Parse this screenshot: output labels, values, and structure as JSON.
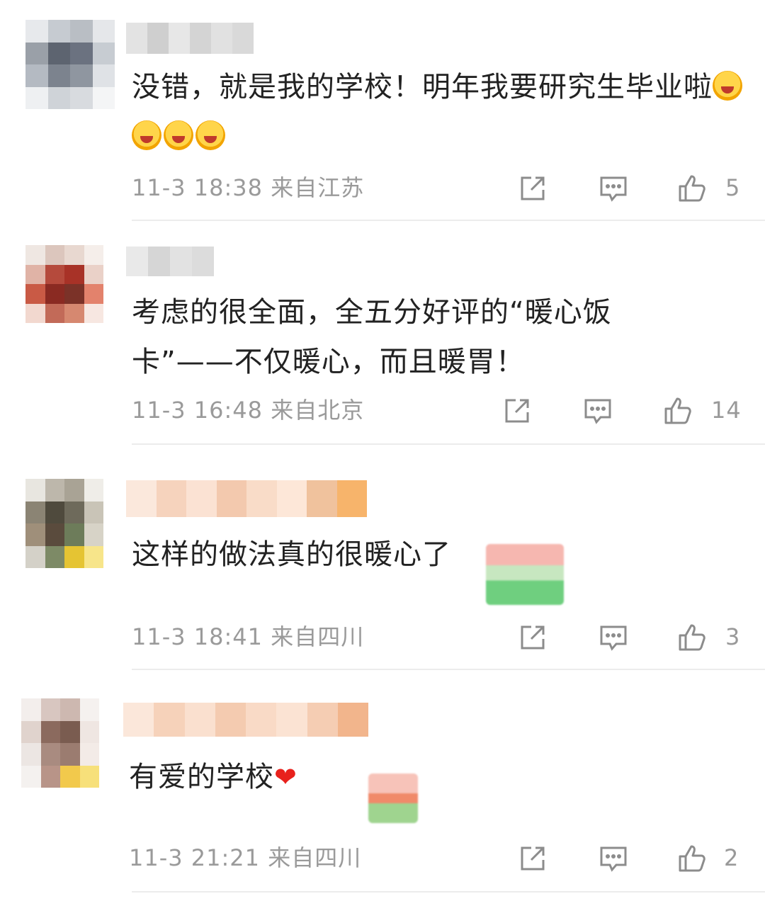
{
  "comments": [
    {
      "text": "没错，就是我的学校！明年我要研究生毕业啦",
      "emoji_icons": [
        "grinning-face-icon",
        "grinning-face-icon",
        "laughing-tears-icon",
        "laughing-tears-icon"
      ],
      "time": "11-3 18:38",
      "location": "来自江苏",
      "likes": "5"
    },
    {
      "text_line1": "考虑的很全面，全五分好评的“暖心饭",
      "text_line2": "卡”——不仅暖心，而且暖胃！",
      "time": "11-3 16:48",
      "location": "来自北京",
      "likes": "14"
    },
    {
      "text": "这样的做法真的很暖心了",
      "time": "11-3 18:41",
      "location": "来自四川",
      "likes": "3"
    },
    {
      "text": "有爱的学校",
      "trailing_icon": "red-heart-icon",
      "heart_glyph": "❤",
      "time": "11-3 21:21",
      "location": "来自四川",
      "likes": "2"
    }
  ],
  "icons": {
    "share": "share-icon",
    "reply": "comment-icon",
    "like": "thumbs-up-icon"
  },
  "colors": {
    "meta_text": "#9a9a9a",
    "icon_stroke": "#8c8c8c",
    "heart": "#e8211c"
  }
}
